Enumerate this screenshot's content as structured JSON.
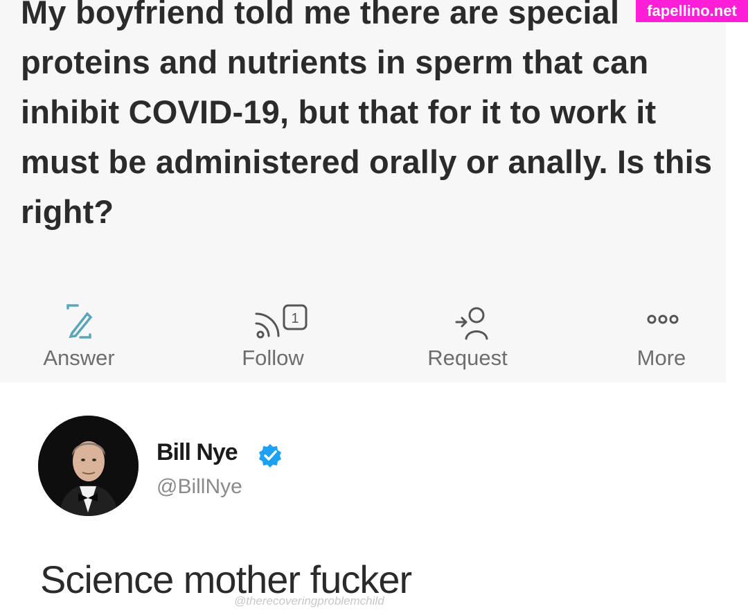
{
  "question": {
    "text": "My boyfriend told me there are special proteins and nutrients in sperm that can inhibit COVID-19, but that for it to work it must be administered orally or anally. Is this right?"
  },
  "actions": [
    {
      "label": "Answer",
      "icon": "edit-icon"
    },
    {
      "label": "Follow",
      "icon": "follow-feed-icon",
      "count": "1"
    },
    {
      "label": "Request",
      "icon": "request-user-icon"
    },
    {
      "label": "More",
      "icon": "more-icon"
    }
  ],
  "watermark": {
    "text": "fapellino.net",
    "color": "#ff1fd7"
  },
  "tweet": {
    "display_name": "Bill Nye",
    "handle": "@BillNye",
    "text": "Science mother fucker",
    "credit": "@therecoveringproblemchild",
    "verified_color": "#1da1f2"
  },
  "colors": {
    "action_icon": "#5aa6b8",
    "question_bg": "#f7f7f7"
  }
}
